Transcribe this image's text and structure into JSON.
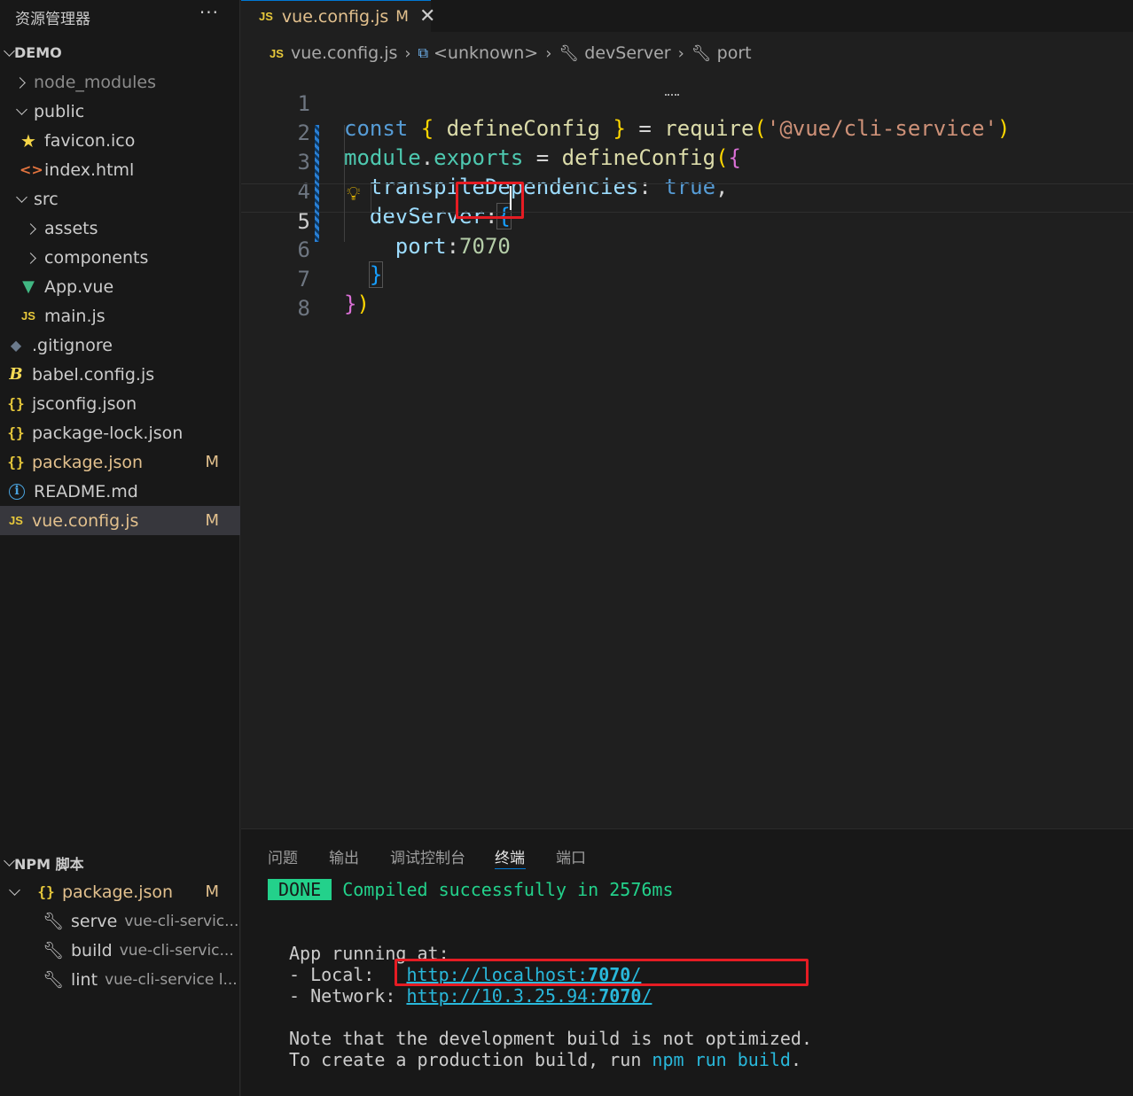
{
  "sidebar": {
    "title": "资源管理器",
    "more": "···",
    "project": "DEMO",
    "tree": [
      {
        "label": "node_modules",
        "badge": ""
      },
      {
        "label": "public",
        "badge": ""
      },
      {
        "label": "favicon.ico",
        "badge": ""
      },
      {
        "label": "index.html",
        "badge": ""
      },
      {
        "label": "src",
        "badge": ""
      },
      {
        "label": "assets",
        "badge": ""
      },
      {
        "label": "components",
        "badge": ""
      },
      {
        "label": "App.vue",
        "badge": ""
      },
      {
        "label": "main.js",
        "badge": ""
      },
      {
        "label": ".gitignore",
        "badge": ""
      },
      {
        "label": "babel.config.js",
        "badge": ""
      },
      {
        "label": "jsconfig.json",
        "badge": ""
      },
      {
        "label": "package-lock.json",
        "badge": ""
      },
      {
        "label": "package.json",
        "badge": "M"
      },
      {
        "label": "README.md",
        "badge": ""
      },
      {
        "label": "vue.config.js",
        "badge": "M"
      }
    ],
    "icons": {
      "js": "JS",
      "json": "{}",
      "html": "<>",
      "info": "i"
    },
    "npm": {
      "title": "NPM 脚本",
      "file": "package.json",
      "file_badge": "M",
      "scripts": [
        {
          "name": "serve",
          "command": "vue-cli-servic..."
        },
        {
          "name": "build",
          "command": "vue-cli-servic..."
        },
        {
          "name": "lint",
          "command": "vue-cli-service l..."
        }
      ]
    }
  },
  "editor": {
    "tab": {
      "title": "vue.config.js",
      "badge": "M",
      "close": "✕"
    },
    "breadcrumb": [
      "vue.config.js",
      "<unknown>",
      "devServer",
      "port"
    ],
    "line_numbers": [
      "1",
      "2",
      "3",
      "4",
      "5",
      "6",
      "7",
      "8"
    ],
    "code": {
      "l1": {
        "kw": "const",
        "ob": "{",
        "name": "defineConfig",
        "cb": "}",
        "eq": "=",
        "fn": "require",
        "op": "(",
        "str": "'@vue/cli-service'",
        "cp": ")"
      },
      "l2": {
        "mod": "module",
        "dot": ".",
        "exp": "exports",
        "eq": "=",
        "fn": "defineConfig",
        "op": "(",
        "ob": "{"
      },
      "l3": {
        "key": "transpileDependencies",
        "colon": ":",
        "val": "true",
        "comma": ","
      },
      "l4": {
        "key": "devServer",
        "colon": ":",
        "ob": "{"
      },
      "l5": {
        "key": "port",
        "colon": ":",
        "val": "7070"
      },
      "l6": {
        "cb": "}"
      },
      "l7": {
        "cb": "}",
        "cp": ")"
      }
    }
  },
  "panel": {
    "tabs": [
      "问题",
      "输出",
      "调试控制台",
      "终端",
      "端口"
    ],
    "active_tab": "终端",
    "terminal": {
      "done_badge": "DONE",
      "compiled": "Compiled successfully in 2576ms",
      "running": "App running at:",
      "local_label": "- Local:   ",
      "local_url_a": "http://localhost:",
      "local_url_b": "7070",
      "local_url_c": "/",
      "network_label": "- Network: ",
      "network_url_a": "http://10.3.25.94:",
      "network_url_b": "7070",
      "network_url_c": "/",
      "note1": "Note that the development build is not optimized.",
      "note2_a": "To create a production build, run ",
      "note2_cmd": "npm run build",
      "note2_b": "."
    }
  },
  "colors": {
    "accent": "#0078d4",
    "highlight_box": "#e51c23",
    "modified": "#e2c08d",
    "success": "#23d18b",
    "link": "#29b8db"
  }
}
